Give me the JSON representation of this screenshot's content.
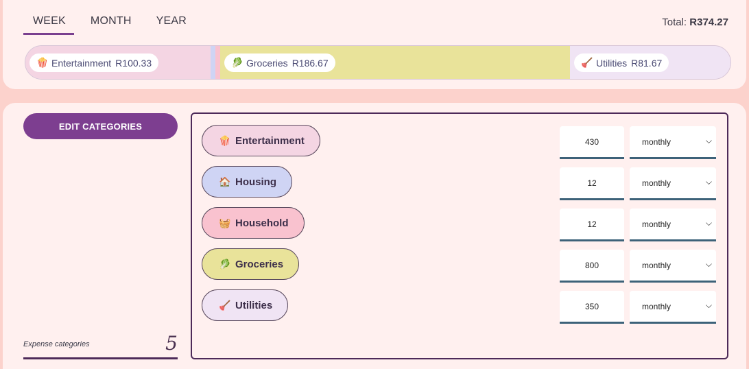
{
  "tabs": [
    {
      "label": "WEEK",
      "active": true
    },
    {
      "label": "MONTH",
      "active": false
    },
    {
      "label": "YEAR",
      "active": false
    }
  ],
  "total": {
    "label": "Total:",
    "value": "R374.27"
  },
  "breakdown": [
    {
      "name": "Entertainment",
      "amount": "R100.33",
      "color": "#f4d5e3",
      "icon": "popcorn-icon"
    },
    {
      "name": "Housing",
      "amount": "",
      "color": "#cfd4f4",
      "icon": "house-icon"
    },
    {
      "name": "Household",
      "amount": "",
      "color": "#f9c2cf",
      "icon": "iron-icon"
    },
    {
      "name": "Groceries",
      "amount": "R186.67",
      "color": "#e9e39a",
      "icon": "lettuce-icon"
    },
    {
      "name": "Utilities",
      "amount": "R81.67",
      "color": "#f0e4f4",
      "icon": "plunger-icon"
    }
  ],
  "edit_button_label": "EDIT CATEGORIES",
  "categories_count_label": "Expense categories",
  "categories_count": "5",
  "categories": [
    {
      "name": "Entertainment",
      "icon": "popcorn-icon",
      "glyph": "🍿",
      "color": "#f4d5e3",
      "amount": "430",
      "frequency": "monthly"
    },
    {
      "name": "Housing",
      "icon": "house-icon",
      "glyph": "🏠",
      "color": "#cfd4f4",
      "amount": "12",
      "frequency": "monthly"
    },
    {
      "name": "Household",
      "icon": "iron-icon",
      "glyph": "🧺",
      "color": "#f9c2cf",
      "amount": "12",
      "frequency": "monthly"
    },
    {
      "name": "Groceries",
      "icon": "lettuce-icon",
      "glyph": "🥬",
      "color": "#e9e39a",
      "amount": "800",
      "frequency": "monthly"
    },
    {
      "name": "Utilities",
      "icon": "plunger-icon",
      "glyph": "🪠",
      "color": "#f0e4f4",
      "amount": "350",
      "frequency": "monthly"
    }
  ],
  "colors": {
    "accent": "#7d3e90",
    "border": "#4d2a59",
    "input_underline": "#3d6279"
  }
}
